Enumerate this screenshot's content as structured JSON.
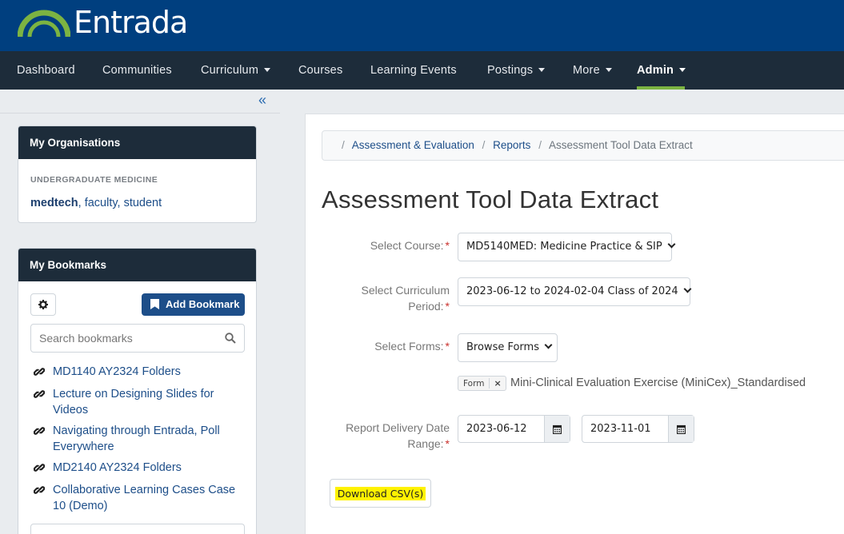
{
  "brand": {
    "name": "Entrada"
  },
  "nav": {
    "items": [
      {
        "label": "Dashboard"
      },
      {
        "label": "Communities"
      },
      {
        "label": "Curriculum"
      },
      {
        "label": "Courses"
      },
      {
        "label": "Learning Events"
      },
      {
        "label": "Postings"
      },
      {
        "label": "More"
      },
      {
        "label": "Admin"
      }
    ]
  },
  "sidebar": {
    "collapse_icon": "«",
    "organisations": {
      "title": "My Organisations",
      "org_label": "UNDERGRADUATE MEDICINE",
      "org_name": "medtech",
      "roles": ", faculty, student"
    },
    "bookmarks": {
      "title": "My Bookmarks",
      "add_label": "Add Bookmark",
      "search_placeholder": "Search bookmarks",
      "items": [
        {
          "label": "MD1140 AY2324 Folders"
        },
        {
          "label": "Lecture on Designing Slides for Videos"
        },
        {
          "label": "Navigating through Entrada, Poll Everywhere"
        },
        {
          "label": "MD2140 AY2324 Folders"
        },
        {
          "label": "Collaborative Learning Cases Case 10 (Demo)"
        }
      ]
    }
  },
  "breadcrumb": {
    "sep": "/",
    "items": [
      {
        "label": "Assessment & Evaluation"
      },
      {
        "label": "Reports"
      },
      {
        "label": "Assessment Tool Data Extract"
      }
    ]
  },
  "page": {
    "title": "Assessment Tool Data Extract",
    "required_mark": "*",
    "fields": {
      "course": {
        "label": "Select Course:",
        "value": "MD5140MED: Medicine Practice & SIP"
      },
      "curriculum": {
        "label_1": "Select Curriculum",
        "label_2": "Period:",
        "value": "2023-06-12 to 2024-02-04 Class of 2024"
      },
      "forms": {
        "label": "Select Forms:",
        "button": "Browse Forms",
        "tag": "Form",
        "tag_remove": "×",
        "selected": "Mini-Clinical Evaluation Exercise (MiniCex)_Standardised"
      },
      "dates": {
        "label_1": "Report Delivery Date",
        "label_2": "Range:",
        "start": "2023-06-12",
        "end": "2023-11-01"
      }
    },
    "download_label": "Download CSV(s)"
  },
  "colors": {
    "brand_blue": "#003f7f",
    "nav_dark": "#1d2c3a",
    "active_underline": "#7cb342",
    "link": "#1d4e89",
    "required": "#c9302c",
    "highlight": "#fff200"
  }
}
